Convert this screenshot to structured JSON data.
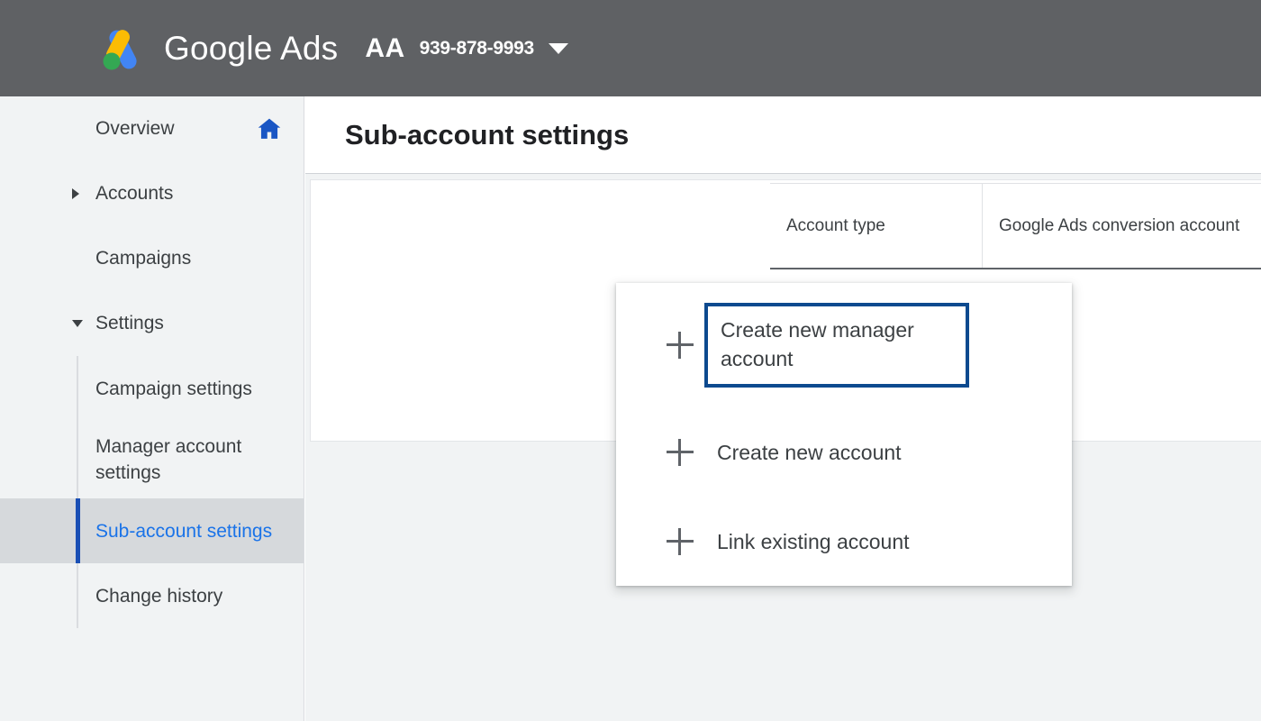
{
  "topbar": {
    "logo_icon": "google-ads-logo",
    "brand": "Google Ads",
    "account_initials": "AA",
    "account_number": "939-878-9993",
    "caret_icon": "chevron-down-icon",
    "background_color": "#5f6164"
  },
  "sidebar": {
    "items": [
      {
        "label": "Overview",
        "icon": "home-icon",
        "expandable": false
      },
      {
        "label": "Accounts",
        "icon": "triangle-right-icon",
        "expandable": true
      },
      {
        "label": "Campaigns",
        "icon": "",
        "expandable": false
      },
      {
        "label": "Settings",
        "icon": "triangle-down-icon",
        "expandable": true
      }
    ],
    "sub_items": [
      {
        "label": "Campaign settings",
        "selected": false
      },
      {
        "label": "Manager account settings",
        "selected": false
      },
      {
        "label": "Sub-account settings",
        "selected": true
      },
      {
        "label": "Change history",
        "selected": false
      }
    ],
    "selected_color": "#1a73e8",
    "selected_bg": "#d6d9dc",
    "background_color": "#f1f3f4"
  },
  "page": {
    "title": "Sub-account settings"
  },
  "menu": {
    "items": [
      {
        "label": "Create new manager account",
        "icon": "plus-icon",
        "focused": true
      },
      {
        "label": "Create new account",
        "icon": "plus-icon",
        "focused": false
      },
      {
        "label": "Link existing account",
        "icon": "plus-icon",
        "focused": false
      }
    ],
    "focus_border_color": "#0d4a8f"
  },
  "table": {
    "columns": [
      {
        "header": "Account type"
      },
      {
        "header": "Google Ads conversion account"
      }
    ],
    "rows": []
  }
}
